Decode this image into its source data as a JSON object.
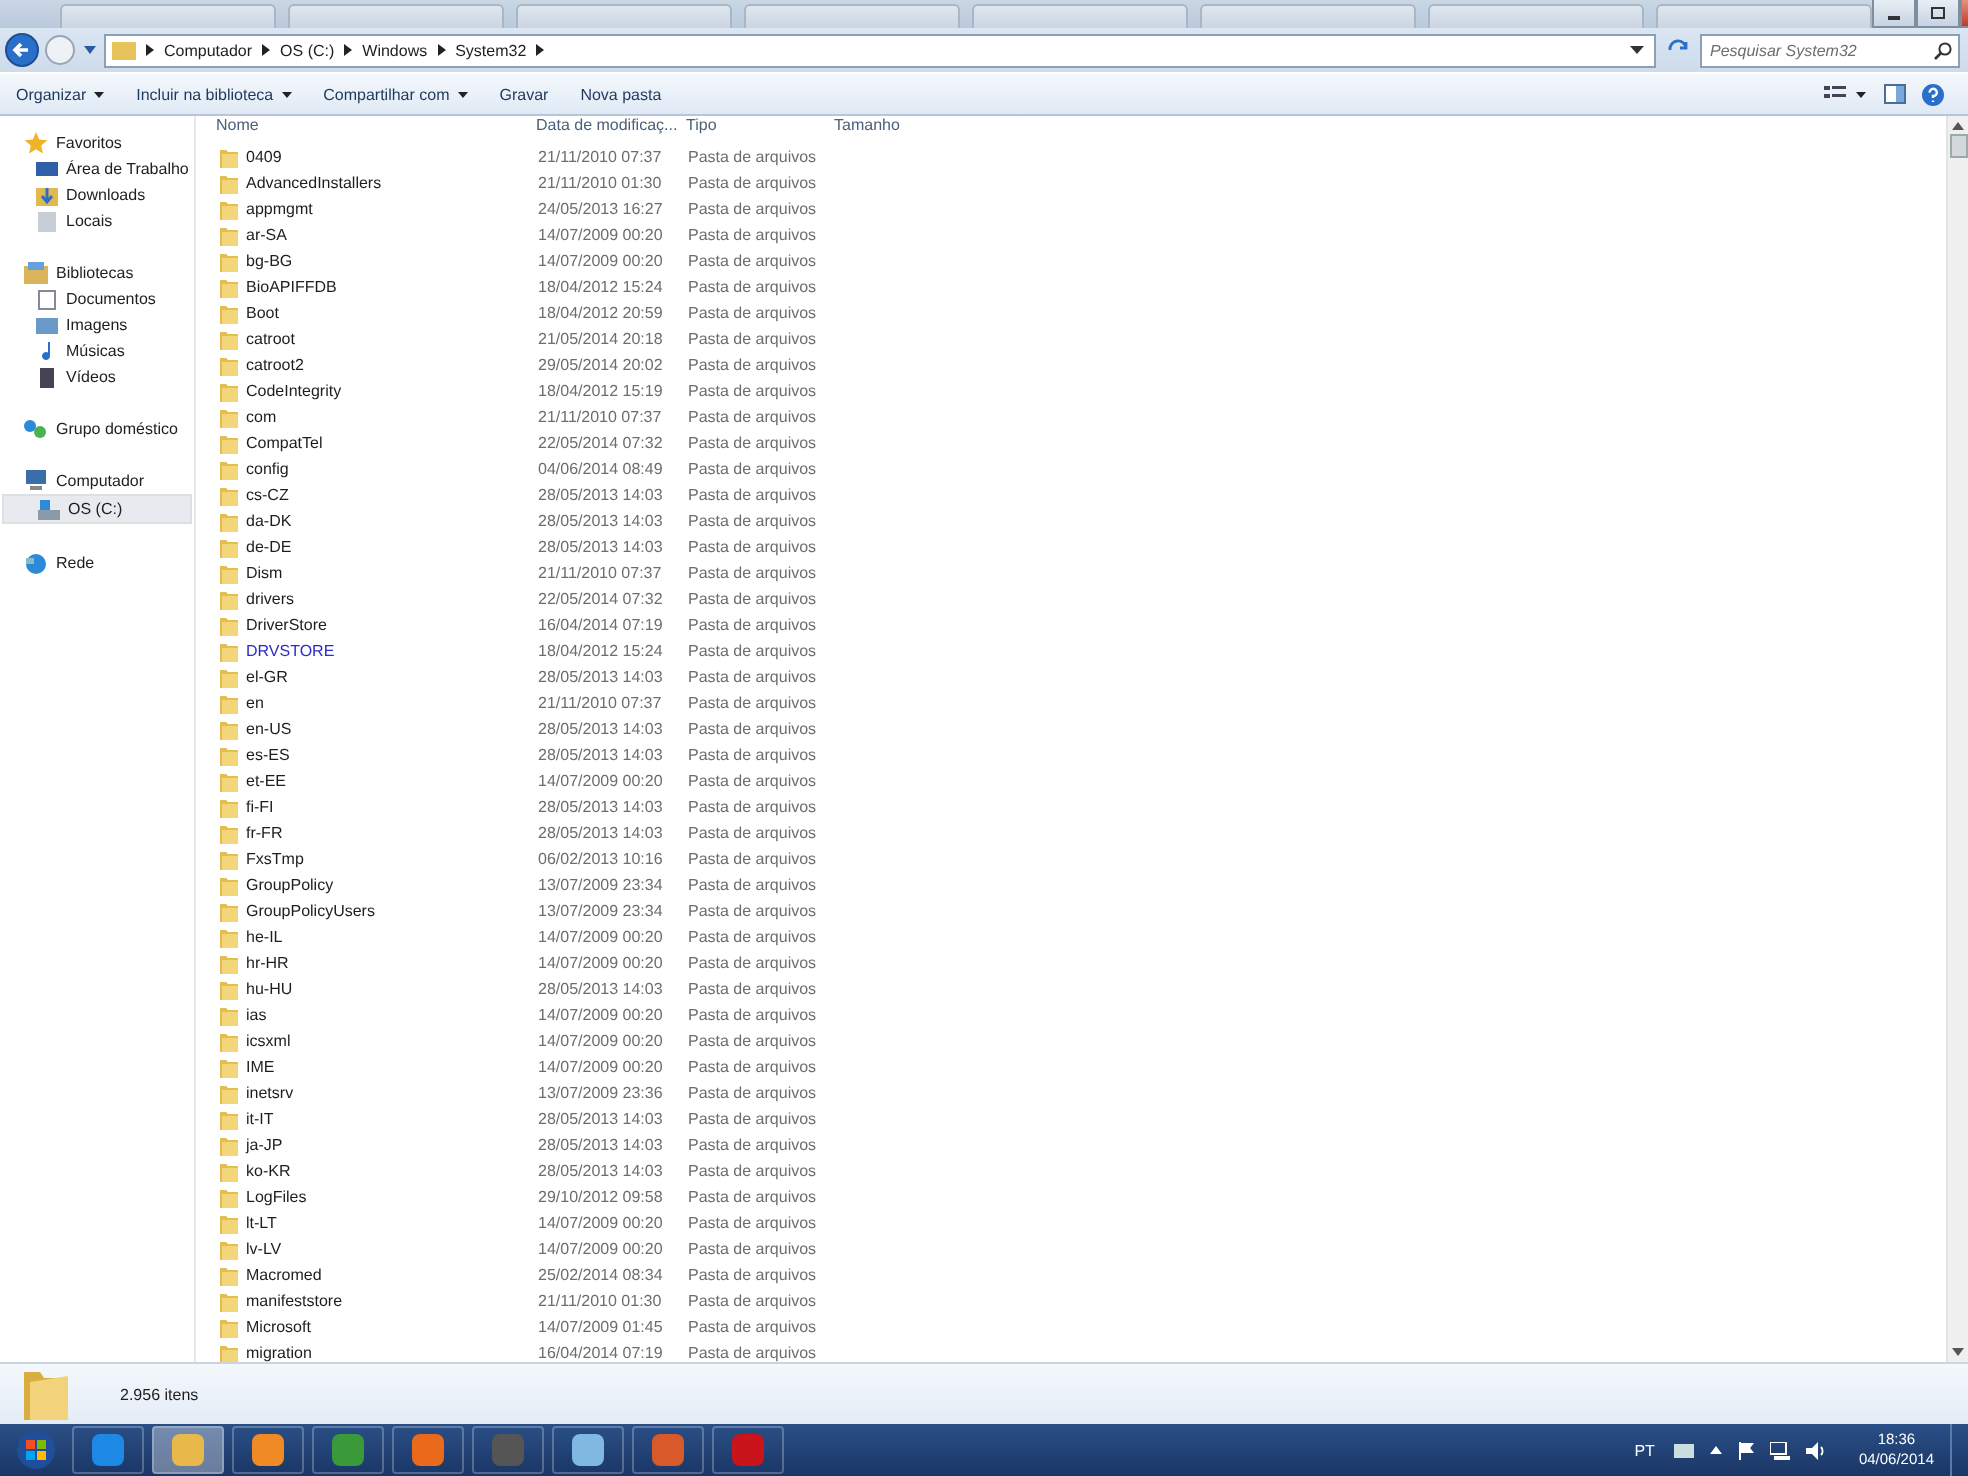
{
  "address": {
    "crumbs": [
      "Computador",
      "OS (C:)",
      "Windows",
      "System32"
    ]
  },
  "search": {
    "placeholder": "Pesquisar System32"
  },
  "toolbar": {
    "buttons": [
      {
        "label": "Organizar",
        "dropdown": true
      },
      {
        "label": "Incluir na biblioteca",
        "dropdown": true
      },
      {
        "label": "Compartilhar com",
        "dropdown": true
      },
      {
        "label": "Gravar",
        "dropdown": false
      },
      {
        "label": "Nova pasta",
        "dropdown": false
      }
    ]
  },
  "sidebar": {
    "groups": [
      {
        "label": "Favoritos",
        "children": [
          {
            "label": "Área de Trabalho",
            "selected": false
          },
          {
            "label": "Downloads",
            "selected": false
          },
          {
            "label": "Locais",
            "selected": false
          }
        ]
      },
      {
        "label": "Bibliotecas",
        "children": [
          {
            "label": "Documentos",
            "selected": false
          },
          {
            "label": "Imagens",
            "selected": false
          },
          {
            "label": "Músicas",
            "selected": false
          },
          {
            "label": "Vídeos",
            "selected": false
          }
        ]
      },
      {
        "label": "Grupo doméstico"
      },
      {
        "label": "Computador",
        "children": [
          {
            "label": "OS (C:)",
            "selected": true
          }
        ]
      },
      {
        "label": "Rede"
      }
    ]
  },
  "table": {
    "columns": [
      "Nome",
      "Data de modificaç...",
      "Tipo",
      "Tamanho"
    ],
    "rows": [
      {
        "name": "0409",
        "date": "21/11/2010 07:37",
        "type": "Pasta de arquivos",
        "compressed": false
      },
      {
        "name": "AdvancedInstallers",
        "date": "21/11/2010 01:30",
        "type": "Pasta de arquivos",
        "compressed": false
      },
      {
        "name": "appmgmt",
        "date": "24/05/2013 16:27",
        "type": "Pasta de arquivos",
        "compressed": false
      },
      {
        "name": "ar-SA",
        "date": "14/07/2009 00:20",
        "type": "Pasta de arquivos",
        "compressed": false
      },
      {
        "name": "bg-BG",
        "date": "14/07/2009 00:20",
        "type": "Pasta de arquivos",
        "compressed": false
      },
      {
        "name": "BioAPIFFDB",
        "date": "18/04/2012 15:24",
        "type": "Pasta de arquivos",
        "compressed": false
      },
      {
        "name": "Boot",
        "date": "18/04/2012 20:59",
        "type": "Pasta de arquivos",
        "compressed": false
      },
      {
        "name": "catroot",
        "date": "21/05/2014 20:18",
        "type": "Pasta de arquivos",
        "compressed": false
      },
      {
        "name": "catroot2",
        "date": "29/05/2014 20:02",
        "type": "Pasta de arquivos",
        "compressed": false
      },
      {
        "name": "CodeIntegrity",
        "date": "18/04/2012 15:19",
        "type": "Pasta de arquivos",
        "compressed": false
      },
      {
        "name": "com",
        "date": "21/11/2010 07:37",
        "type": "Pasta de arquivos",
        "compressed": false
      },
      {
        "name": "CompatTel",
        "date": "22/05/2014 07:32",
        "type": "Pasta de arquivos",
        "compressed": false
      },
      {
        "name": "config",
        "date": "04/06/2014 08:49",
        "type": "Pasta de arquivos",
        "compressed": false
      },
      {
        "name": "cs-CZ",
        "date": "28/05/2013 14:03",
        "type": "Pasta de arquivos",
        "compressed": false
      },
      {
        "name": "da-DK",
        "date": "28/05/2013 14:03",
        "type": "Pasta de arquivos",
        "compressed": false
      },
      {
        "name": "de-DE",
        "date": "28/05/2013 14:03",
        "type": "Pasta de arquivos",
        "compressed": false
      },
      {
        "name": "Dism",
        "date": "21/11/2010 07:37",
        "type": "Pasta de arquivos",
        "compressed": false
      },
      {
        "name": "drivers",
        "date": "22/05/2014 07:32",
        "type": "Pasta de arquivos",
        "compressed": false
      },
      {
        "name": "DriverStore",
        "date": "16/04/2014 07:19",
        "type": "Pasta de arquivos",
        "compressed": false
      },
      {
        "name": "DRVSTORE",
        "date": "18/04/2012 15:24",
        "type": "Pasta de arquivos",
        "compressed": true
      },
      {
        "name": "el-GR",
        "date": "28/05/2013 14:03",
        "type": "Pasta de arquivos",
        "compressed": false
      },
      {
        "name": "en",
        "date": "21/11/2010 07:37",
        "type": "Pasta de arquivos",
        "compressed": false
      },
      {
        "name": "en-US",
        "date": "28/05/2013 14:03",
        "type": "Pasta de arquivos",
        "compressed": false
      },
      {
        "name": "es-ES",
        "date": "28/05/2013 14:03",
        "type": "Pasta de arquivos",
        "compressed": false
      },
      {
        "name": "et-EE",
        "date": "14/07/2009 00:20",
        "type": "Pasta de arquivos",
        "compressed": false
      },
      {
        "name": "fi-FI",
        "date": "28/05/2013 14:03",
        "type": "Pasta de arquivos",
        "compressed": false
      },
      {
        "name": "fr-FR",
        "date": "28/05/2013 14:03",
        "type": "Pasta de arquivos",
        "compressed": false
      },
      {
        "name": "FxsTmp",
        "date": "06/02/2013 10:16",
        "type": "Pasta de arquivos",
        "compressed": false
      },
      {
        "name": "GroupPolicy",
        "date": "13/07/2009 23:34",
        "type": "Pasta de arquivos",
        "compressed": false
      },
      {
        "name": "GroupPolicyUsers",
        "date": "13/07/2009 23:34",
        "type": "Pasta de arquivos",
        "compressed": false
      },
      {
        "name": "he-IL",
        "date": "14/07/2009 00:20",
        "type": "Pasta de arquivos",
        "compressed": false
      },
      {
        "name": "hr-HR",
        "date": "14/07/2009 00:20",
        "type": "Pasta de arquivos",
        "compressed": false
      },
      {
        "name": "hu-HU",
        "date": "28/05/2013 14:03",
        "type": "Pasta de arquivos",
        "compressed": false
      },
      {
        "name": "ias",
        "date": "14/07/2009 00:20",
        "type": "Pasta de arquivos",
        "compressed": false
      },
      {
        "name": "icsxml",
        "date": "14/07/2009 00:20",
        "type": "Pasta de arquivos",
        "compressed": false
      },
      {
        "name": "IME",
        "date": "14/07/2009 00:20",
        "type": "Pasta de arquivos",
        "compressed": false
      },
      {
        "name": "inetsrv",
        "date": "13/07/2009 23:36",
        "type": "Pasta de arquivos",
        "compressed": false
      },
      {
        "name": "it-IT",
        "date": "28/05/2013 14:03",
        "type": "Pasta de arquivos",
        "compressed": false
      },
      {
        "name": "ja-JP",
        "date": "28/05/2013 14:03",
        "type": "Pasta de arquivos",
        "compressed": false
      },
      {
        "name": "ko-KR",
        "date": "28/05/2013 14:03",
        "type": "Pasta de arquivos",
        "compressed": false
      },
      {
        "name": "LogFiles",
        "date": "29/10/2012 09:58",
        "type": "Pasta de arquivos",
        "compressed": false
      },
      {
        "name": "lt-LT",
        "date": "14/07/2009 00:20",
        "type": "Pasta de arquivos",
        "compressed": false
      },
      {
        "name": "lv-LV",
        "date": "14/07/2009 00:20",
        "type": "Pasta de arquivos",
        "compressed": false
      },
      {
        "name": "Macromed",
        "date": "25/02/2014 08:34",
        "type": "Pasta de arquivos",
        "compressed": false
      },
      {
        "name": "manifeststore",
        "date": "21/11/2010 01:30",
        "type": "Pasta de arquivos",
        "compressed": false
      },
      {
        "name": "Microsoft",
        "date": "14/07/2009 01:45",
        "type": "Pasta de arquivos",
        "compressed": false
      },
      {
        "name": "migration",
        "date": "16/04/2014 07:19",
        "type": "Pasta de arquivos",
        "compressed": false
      }
    ]
  },
  "status_bar": {
    "count": "2.956 itens"
  },
  "taskbar": {
    "apps": [
      {
        "selected": false
      },
      {
        "selected": true
      },
      {
        "selected": false
      },
      {
        "selected": false
      },
      {
        "selected": false
      },
      {
        "selected": false
      },
      {
        "selected": false
      },
      {
        "selected": false
      },
      {
        "selected": false
      }
    ],
    "language": "PT",
    "time": "18:36",
    "date": "04/06/2014"
  }
}
